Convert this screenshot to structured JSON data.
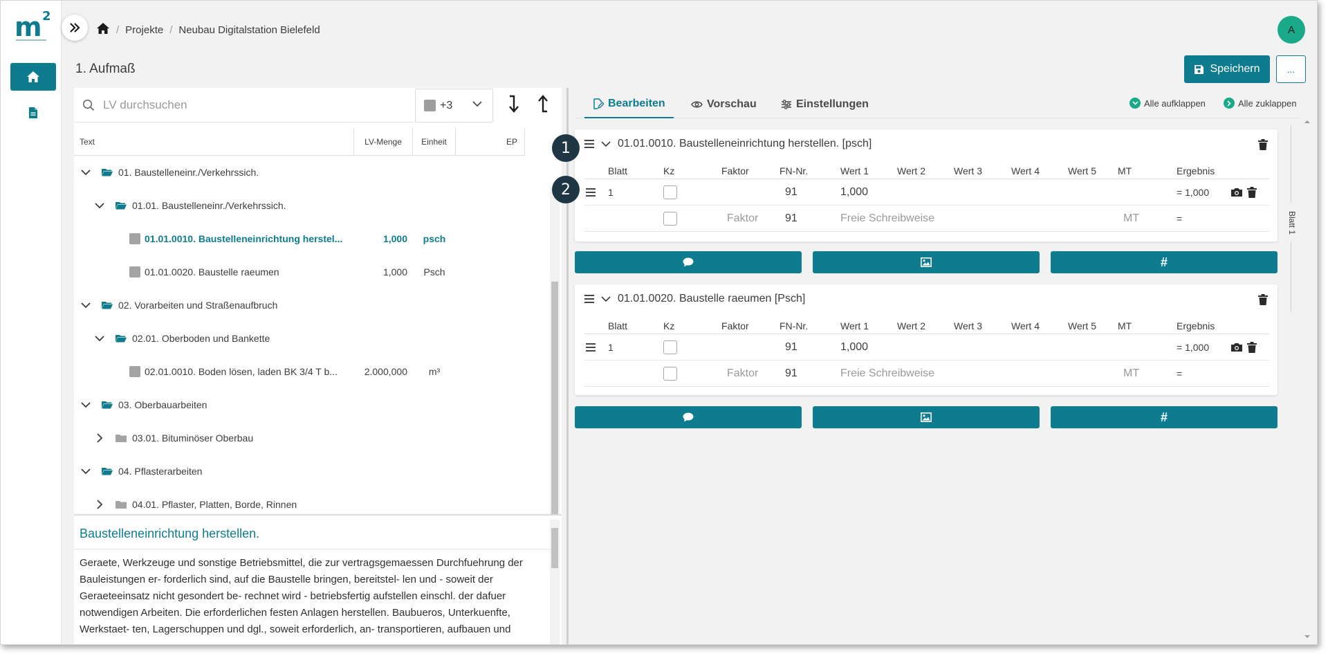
{
  "breadcrumb": [
    "Projekte",
    "Neubau Digitalstation Bielefeld"
  ],
  "avatar": "A",
  "page_title": "1. Aufmaß",
  "save_label": "Speichern",
  "more_label": "...",
  "search": {
    "placeholder": "LV durchsuchen"
  },
  "filter": {
    "label": "+3"
  },
  "columns": {
    "text": "Text",
    "qty": "LV-Menge",
    "unit": "Einheit",
    "ep": "EP"
  },
  "tree": [
    {
      "label": "01. Baustelleneinr./Verkehrssich."
    },
    {
      "label": "01.01. Baustelleneinr./Verkehrssich."
    },
    {
      "label": "01.01.0010. Baustelleneinrichtung herstel...",
      "qty": "1,000",
      "unit": "psch"
    },
    {
      "label": "01.01.0020. Baustelle raeumen",
      "qty": "1,000",
      "unit": "Psch"
    },
    {
      "label": "02. Vorarbeiten und Straßenaufbruch"
    },
    {
      "label": "02.01. Oberboden und Bankette"
    },
    {
      "label": "02.01.0010. Boden lösen, laden BK 3/4 T b...",
      "qty": "2.000,000",
      "unit": "m³"
    },
    {
      "label": "03. Oberbauarbeiten"
    },
    {
      "label": "03.01. Bituminöser Oberbau"
    },
    {
      "label": "04. Pflasterarbeiten"
    },
    {
      "label": "04.01. Pflaster, Platten, Borde, Rinnen"
    }
  ],
  "description": {
    "title": "Baustelleneinrichtung herstellen.",
    "text": "Geraete, Werkzeuge und sonstige Betriebsmittel, die zur vertragsgemaessen Durchfuehrung der Bauleistungen er- forderlich sind, auf die Baustelle bringen, bereitstel- len und - soweit der Geraeteeinsatz nicht gesondert be- rechnet wird - betriebsfertig aufstellen einschl. der dafuer notwendigen Arbeiten. Die erforderlichen festen Anlagen herstellen. Baubueros, Unterkuenfte, Werkstaet- ten, Lagerschuppen und dgl., soweit erforderlich, an- transportieren, aufbauen und"
  },
  "tabs": [
    "Bearbeiten",
    "Vorschau",
    "Einstellungen"
  ],
  "expand_all": "Alle aufklappen",
  "collapse_all": "Alle zuklappen",
  "grid_columns": [
    "Blatt",
    "Kz",
    "Faktor",
    "FN-Nr.",
    "Wert 1",
    "Wert 2",
    "Wert 3",
    "Wert 4",
    "Wert 5",
    "MT",
    "Ergebnis"
  ],
  "cards": [
    {
      "title": "01.01.0010. Baustelleneinrichtung herstellen. [psch]",
      "row": {
        "blatt": "1",
        "fn": "91",
        "wert1": "1,000",
        "ergebnis": "= 1,000"
      },
      "template": {
        "faktor": "Faktor",
        "fn": "91",
        "wert1": "Freie Schreibweise",
        "mt": "MT",
        "ergebnis": "="
      }
    },
    {
      "title": "01.01.0020. Baustelle raeumen [Psch]",
      "row": {
        "blatt": "1",
        "fn": "91",
        "wert1": "1,000",
        "ergebnis": "= 1,000"
      },
      "template": {
        "faktor": "Faktor",
        "fn": "91",
        "wert1": "Freie Schreibweise",
        "mt": "MT",
        "ergebnis": "="
      }
    }
  ],
  "action_icons": [
    "comment-icon",
    "image-icon",
    "hash-icon"
  ],
  "hash_symbol": "#",
  "badges": [
    "1",
    "2"
  ],
  "blatt_label": "Blatt 1",
  "colors": {
    "accent": "#0e7c8e",
    "avatar": "#1aaa8a",
    "badge": "#1f3645"
  }
}
